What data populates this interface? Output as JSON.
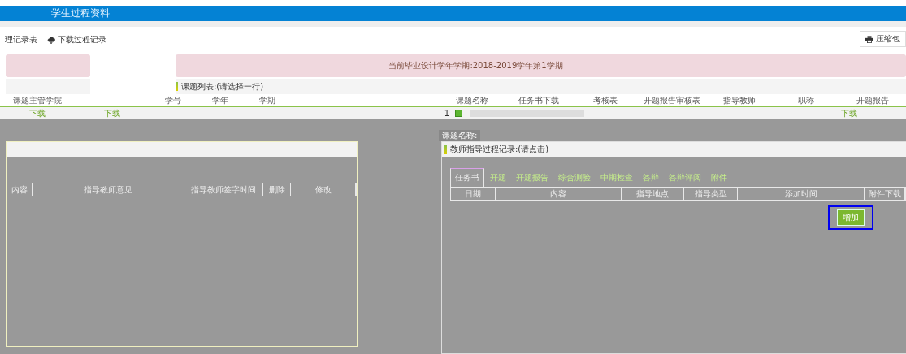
{
  "header": {
    "title": "学生过程资料"
  },
  "toolbar": {
    "buttons": [
      {
        "label": "理记录表"
      },
      {
        "label": "下载过程记录"
      }
    ],
    "print_button": "压缩包"
  },
  "banner": {
    "text": "当前毕业设计学年学期:2018-2019学年第1学期"
  },
  "topic_list": {
    "title": "课题列表:(请选择一行)",
    "left_columns": [
      "课题主管学院"
    ],
    "left_cells": [
      "下载",
      "下载"
    ],
    "columns": [
      "学号",
      "学年",
      "学期"
    ],
    "right_columns": [
      "课题名称",
      "任务书下载",
      "考核表",
      "开题报告审核表",
      "指导教师",
      "职称",
      "开题报告"
    ],
    "row": {
      "index": "1",
      "checked": true,
      "link": "下载"
    }
  },
  "left_dialog": {
    "columns": [
      "内容",
      "指导教师意见",
      "指导教师签字时间",
      "删除",
      "修改"
    ]
  },
  "right_dialog": {
    "topic_label": "课题名称:",
    "title": "教师指导过程记录:(请点击)",
    "tabs": [
      {
        "label": "任务书",
        "selected": true
      },
      {
        "label": "开题",
        "selected": false
      },
      {
        "label": "开题报告",
        "selected": false
      },
      {
        "label": "综合测验",
        "selected": false
      },
      {
        "label": "中期检查",
        "selected": false
      },
      {
        "label": "答辩",
        "selected": false
      },
      {
        "label": "答辩评阅",
        "selected": false
      },
      {
        "label": "附件",
        "selected": false
      }
    ],
    "columns": [
      "日期",
      "内容",
      "指导地点",
      "指导类型",
      "添加时间",
      "附件下载"
    ],
    "add_button": "增加"
  }
}
